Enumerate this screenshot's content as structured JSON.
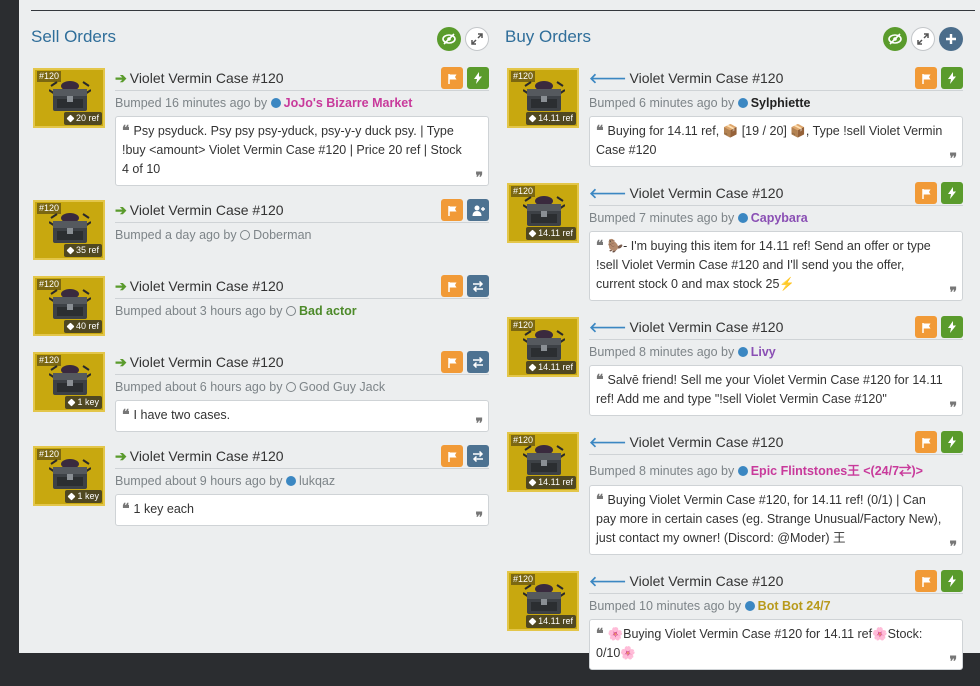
{
  "sell": {
    "title": "Sell Orders",
    "listings": [
      {
        "num": "#120",
        "price": "20 ref",
        "title": "Violet Vermin Case #120",
        "bumped": "Bumped 16 minutes ago by",
        "user": "JoJo's Bizarre Market",
        "user_color": "#c83a9b",
        "status": "online",
        "comment": "Psy psyduck. Psy psy psy-yduck, psy-y-y duck psy. | Type !buy <amount> Violet Vermin Case #120 | Price 20 ref | Stock 4 of 10",
        "second_btn": "trade"
      },
      {
        "num": "#120",
        "price": "35 ref",
        "title": "Violet Vermin Case #120",
        "bumped": "Bumped a day ago by",
        "user": "Doberman",
        "user_color": "#7d8488",
        "status": "offline",
        "comment": "",
        "second_btn": "add-friend"
      },
      {
        "num": "#120",
        "price": "40 ref",
        "title": "Violet Vermin Case #120",
        "bumped": "Bumped about 3 hours ago by",
        "user": "Bad actor",
        "user_color": "#4d8a2a",
        "status": "offline",
        "comment": "",
        "second_btn": "trade-offer"
      },
      {
        "num": "#120",
        "price": "1 key",
        "title": "Violet Vermin Case #120",
        "bumped": "Bumped about 6 hours ago by",
        "user": "Good Guy Jack",
        "user_color": "#7d8488",
        "status": "offline",
        "comment": "I have two cases.",
        "second_btn": "trade-offer"
      },
      {
        "num": "#120",
        "price": "1 key",
        "title": "Violet Vermin Case #120",
        "bumped": "Bumped about 9 hours ago by",
        "user": "lukqaz",
        "user_color": "#7d8488",
        "status": "online",
        "comment": "1 key each",
        "second_btn": "trade-offer"
      }
    ]
  },
  "buy": {
    "title": "Buy Orders",
    "listings": [
      {
        "num": "#120",
        "price": "14.11 ref",
        "title": "Violet Vermin Case #120",
        "bumped": "Bumped 6 minutes ago by",
        "user": "Sylphiette",
        "user_color": "#222222",
        "status": "online",
        "comment": "Buying for 14.11 ref, 📦 [19 / 20] 📦, Type !sell Violet Vermin Case #120",
        "second_btn": "trade"
      },
      {
        "num": "#120",
        "price": "14.11 ref",
        "title": "Violet Vermin Case #120",
        "bumped": "Bumped 7 minutes ago by",
        "user": "Capybara",
        "user_color": "#8a4fb4",
        "status": "online",
        "comment": "🦫- I'm buying this item for 14.11 ref! Send an offer or type !sell Violet Vermin Case #120 and I'll send you the offer, current stock 0 and max stock 25⚡",
        "second_btn": "trade"
      },
      {
        "num": "#120",
        "price": "14.11 ref",
        "title": "Violet Vermin Case #120",
        "bumped": "Bumped 8 minutes ago by",
        "user": "Livy",
        "user_color": "#8a4fb4",
        "status": "online",
        "comment": "Salvē friend! Sell me your Violet Vermin Case #120 for 14.11 ref! Add me and type \"!sell Violet Vermin Case #120\"",
        "second_btn": "trade"
      },
      {
        "num": "#120",
        "price": "14.11 ref",
        "title": "Violet Vermin Case #120",
        "bumped": "Bumped 8 minutes ago by",
        "user": "Epic Flintstones王 <(24/7⇄)>",
        "user_color": "#c83a9b",
        "status": "online",
        "comment": "Buying Violet Vermin Case #120, for 14.11 ref! (0/1) | Can pay more in certain cases (eg. Strange Unusual/Factory New), just contact my owner! (Discord: @Moder) 王",
        "second_btn": "trade"
      },
      {
        "num": "#120",
        "price": "14.11 ref",
        "title": "Violet Vermin Case #120",
        "bumped": "Bumped 10 minutes ago by",
        "user": "Bot Bot 24/7",
        "user_color": "#b89a1c",
        "status": "online",
        "comment": "🌸Buying Violet Vermin Case #120 for 14.11 ref🌸Stock: 0/10🌸",
        "second_btn": "trade"
      }
    ]
  },
  "colors": {
    "accent_blue": "#2f6e9a",
    "orange": "#f19a37",
    "green": "#5a9b2c",
    "slate": "#4d7291",
    "item_bg": "#c8a80f"
  }
}
